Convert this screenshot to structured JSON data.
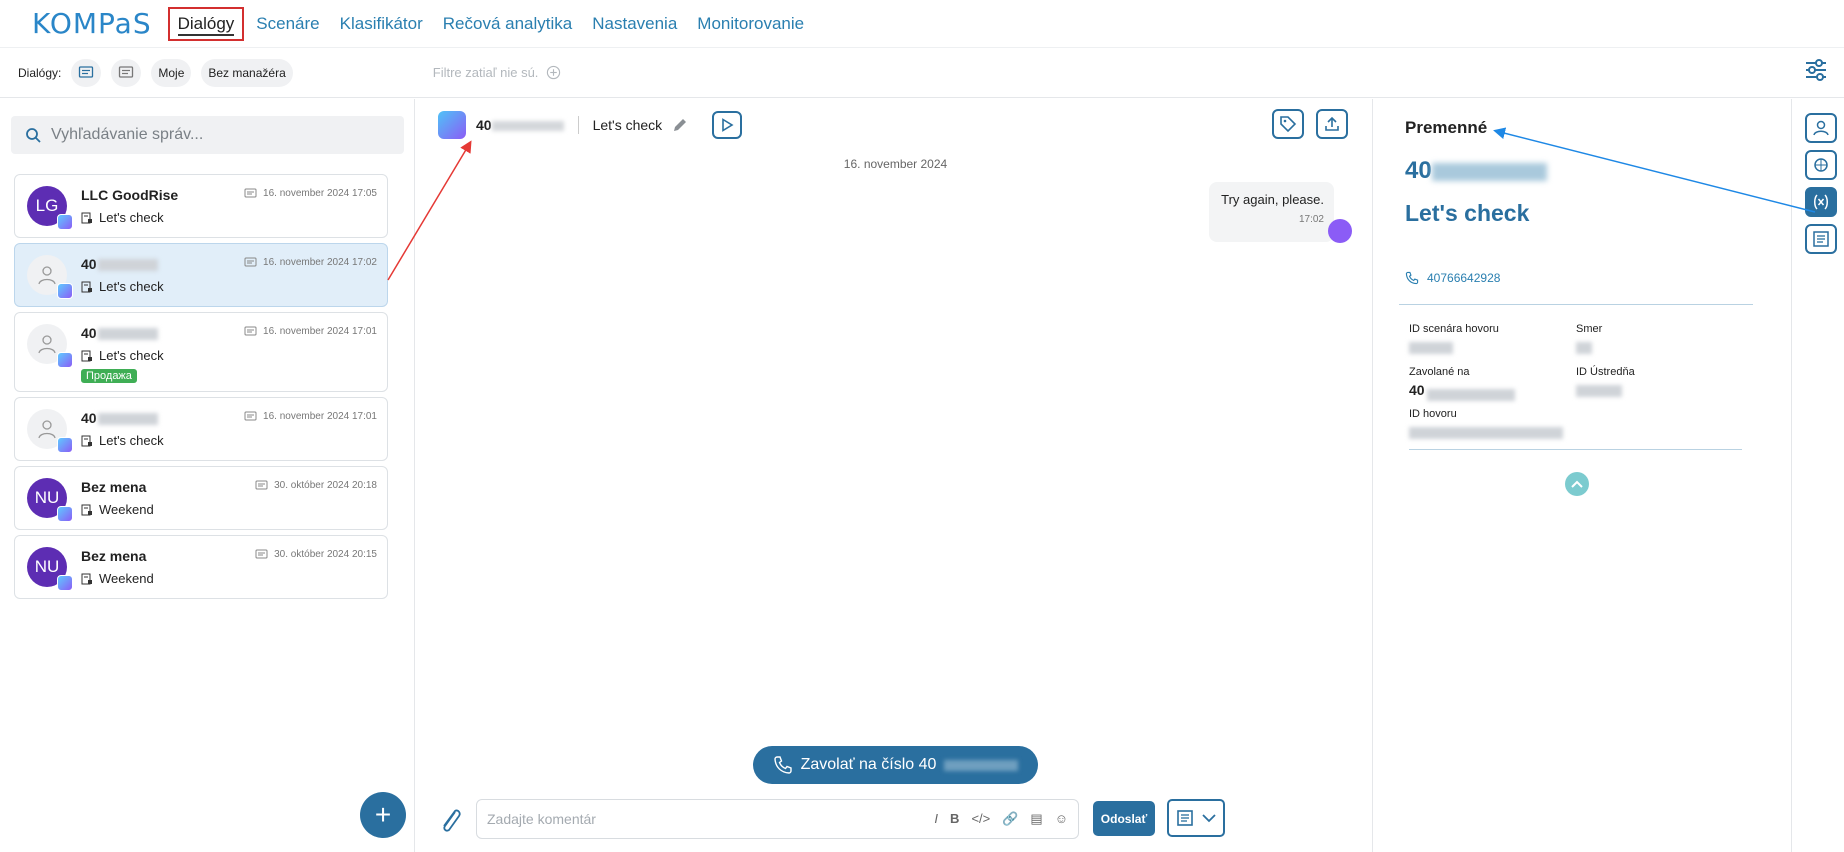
{
  "app": {
    "logo": "KOMPaS"
  },
  "nav": {
    "items": [
      {
        "label": "Dialógy",
        "active": true
      },
      {
        "label": "Scenáre"
      },
      {
        "label": "Klasifikátor"
      },
      {
        "label": "Rečová analytika"
      },
      {
        "label": "Nastavenia"
      },
      {
        "label": "Monitorovanie"
      }
    ]
  },
  "filter_bar": {
    "label": "Dialógy:",
    "chip_my": "Moje",
    "chip_no_manager": "Bez manažéra",
    "no_filters": "Filtre zatiaľ nie sú."
  },
  "search": {
    "placeholder": "Vyhľadávanie správ..."
  },
  "dialogs": [
    {
      "initials": "LG",
      "name": "LLC GoodRise",
      "date": "16. november 2024 17:05",
      "message": "Let's check"
    },
    {
      "initials": "",
      "name": "40",
      "date": "16. november 2024 17:02",
      "message": "Let's check"
    },
    {
      "initials": "",
      "name": "40",
      "date": "16. november 2024 17:01",
      "message": "Let's check",
      "tag": "Продажа"
    },
    {
      "initials": "",
      "name": "40",
      "date": "16. november 2024 17:01",
      "message": "Let's check"
    },
    {
      "initials": "NU",
      "name": "Bez mena",
      "date": "30. október 2024 20:18",
      "message": "Weekend"
    },
    {
      "initials": "NU",
      "name": "Bez mena",
      "date": "30. október 2024 20:15",
      "message": "Weekend"
    }
  ],
  "chat": {
    "phone": "40",
    "title": "Let's check",
    "date": "16. november 2024",
    "message": {
      "text": "Try again, please.",
      "time": "17:02"
    },
    "call_button": "Zavolať na číslo  40",
    "composer_placeholder": "Zadajte komentár",
    "send": "Odoslať"
  },
  "panel": {
    "title": "Premenné",
    "phone": "40",
    "name": "Let's check",
    "link": "40766642928",
    "fields": {
      "scenario_label": "ID scenára hovoru",
      "direction_label": "Smer",
      "called_label": "Zavolané na",
      "called_value": "40",
      "central_label": "ID Ústredňa",
      "call_id_label": "ID hovoru"
    }
  },
  "colors": {
    "brand": "#2a6f9f",
    "accent": "#2a86c8",
    "highlight": "#d32f2f"
  }
}
